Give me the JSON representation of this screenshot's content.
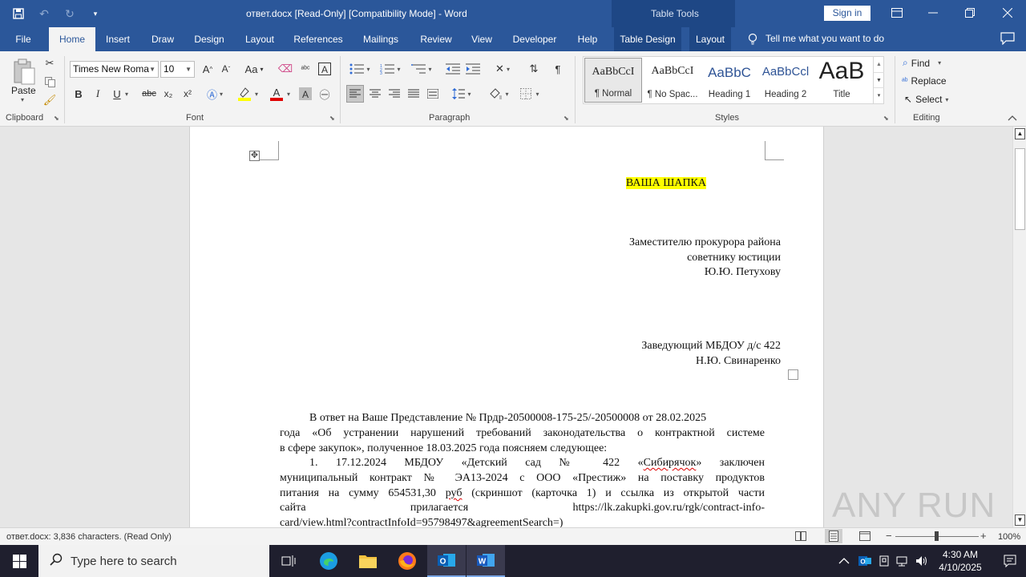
{
  "titlebar": {
    "document_title": "ответ.docx [Read-Only] [Compatibility Mode]  -  Word",
    "contextual_tools": "Table Tools",
    "sign_in": "Sign in"
  },
  "tabs": [
    "File",
    "Home",
    "Insert",
    "Draw",
    "Design",
    "Layout",
    "References",
    "Mailings",
    "Review",
    "View",
    "Developer",
    "Help",
    "Table Design",
    "Layout"
  ],
  "active_tab": "Home",
  "tell_me": "Tell me what you want to do",
  "ribbon": {
    "clipboard": {
      "label": "Clipboard",
      "paste": "Paste"
    },
    "font": {
      "label": "Font",
      "font_name": "Times New Roma",
      "font_size": "10",
      "aa": "Aa",
      "bold": "B",
      "italic": "I",
      "underline": "U",
      "strike": "abc",
      "subscript": "x₂",
      "superscript": "x²"
    },
    "paragraph": {
      "label": "Paragraph"
    },
    "styles": {
      "label": "Styles",
      "items": [
        {
          "sample": "AaBbCcI",
          "name": "¶ Normal"
        },
        {
          "sample": "AaBbCcI",
          "name": "¶ No Spac..."
        },
        {
          "sample": "AaBbC",
          "name": "Heading 1"
        },
        {
          "sample": "AaBbCcl",
          "name": "Heading 2"
        },
        {
          "sample": "AaB",
          "name": "Title"
        }
      ]
    },
    "editing": {
      "label": "Editing",
      "find": "Find",
      "replace": "Replace",
      "select": "Select"
    }
  },
  "document": {
    "header_placeholder": "ВАША ШАПКА",
    "addressee": [
      "Заместителю прокурора района",
      "советнику юстиции",
      "Ю.Ю. Петухову"
    ],
    "sender": [
      "Заведующий МБДОУ д/с 422",
      "Н.Ю. Свинаренко"
    ],
    "body": [
      "В ответ на Ваше Представление № Прдр-20500008-175-25/-20500008  от 28.02.2025",
      "года «Об  устранении нарушений требований законодательства о контрактной системе",
      "в сфере закупок», полученное 18.03.2025 года поясняем следующее:",
      "1.          17.12.2024  МБДОУ  «Детский  сад  №  422  «Сибирячок»  заключен",
      "муниципальный  контракт  №  ЭА13-2024  с  ООО  «Престиж»  на  поставку  продуктов",
      "питания  на  сумму  654531,30  руб  (скриншот  (карточка  1)  и  ссылка  из  открытой  части",
      "сайта                         прилагается                         https://lk.zakupki.gov.ru/rgk/contract-info-",
      "card/view.html?contractInfoId=95798497&agreementSearch=)"
    ]
  },
  "statusbar": {
    "info": "ответ.docx: 3,836 characters.  (Read Only)",
    "zoom": "100%"
  },
  "taskbar": {
    "search_placeholder": "Type here to search",
    "time": "4:30 AM",
    "date": "4/10/2025"
  },
  "watermark": "ANY RUN"
}
